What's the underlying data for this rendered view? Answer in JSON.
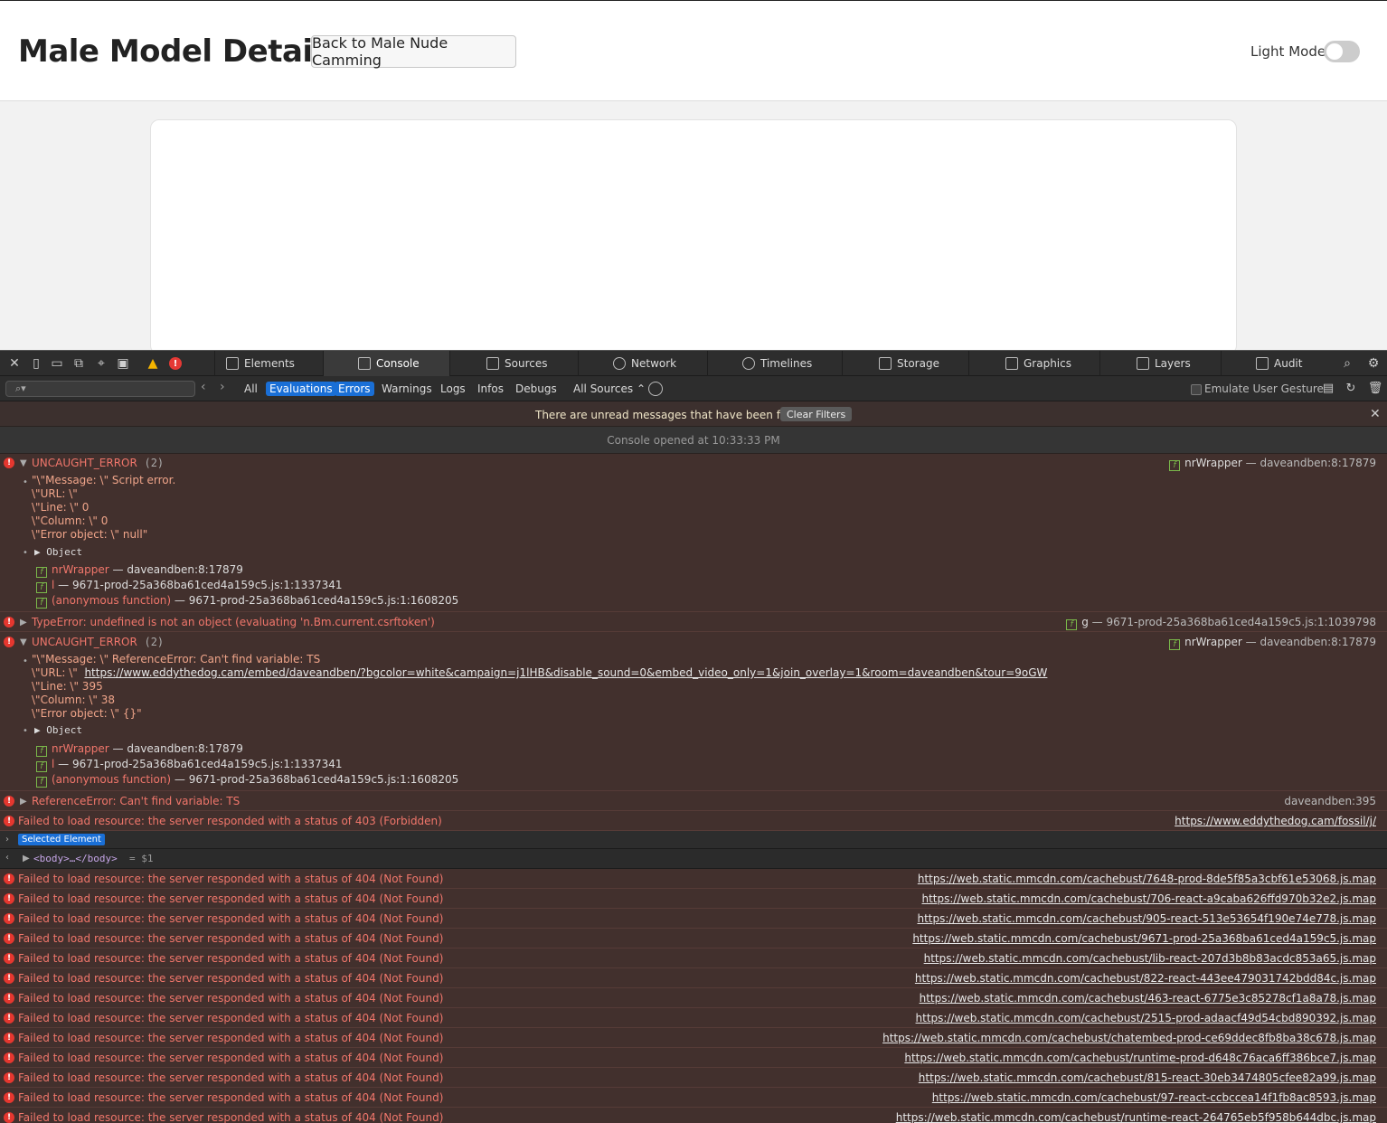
{
  "page": {
    "title": "Male Model Details",
    "back_button": "Back to Male Nude Camming",
    "light_mode_label": "Light Mode"
  },
  "devtools": {
    "tabs": [
      "Elements",
      "Console",
      "Sources",
      "Network",
      "Timelines",
      "Storage",
      "Graphics",
      "Layers",
      "Audit"
    ],
    "levels": [
      "All",
      "Evaluations",
      "Errors",
      "Warnings",
      "Logs",
      "Infos",
      "Debugs"
    ],
    "sources_select": "All Sources ⌃",
    "emulate_label": "Emulate User Gesture",
    "filter_banner": "There are unread messages that have been filtered",
    "clear_filters": "Clear Filters",
    "console_opened": "Console opened at 10:33:33 PM",
    "selected_element": "Selected Element",
    "eval_line": "<body>…</body>",
    "eval_result": "= $1"
  },
  "messages": {
    "m1": {
      "title": "UNCAUGHT_ERROR",
      "count": "(2)",
      "loc_fn": "nrWrapper",
      "loc_file": "— daveandben:8:17879",
      "lines": [
        "\"\\\"Message: \\\" Script error.",
        "\\\"URL: \\\"",
        "\\\"Line: \\\" 0",
        "\\\"Column: \\\" 0",
        "\\\"Error object: \\\" null\""
      ],
      "object": "Object",
      "stack": [
        {
          "fn": "nrWrapper",
          "loc": "— daveandben:8:17879"
        },
        {
          "fn": "l",
          "loc": "— 9671-prod-25a368ba61ced4a159c5.js:1:1337341"
        },
        {
          "fn": "(anonymous function)",
          "loc": "— 9671-prod-25a368ba61ced4a159c5.js:1:1608205"
        }
      ]
    },
    "m2": {
      "title": "TypeError: undefined is not an object (evaluating 'n.Bm.current.csrftoken')",
      "loc_fn": "g",
      "loc_file": "— 9671-prod-25a368ba61ced4a159c5.js:1:1039798"
    },
    "m3": {
      "title": "UNCAUGHT_ERROR",
      "count": "(2)",
      "loc_fn": "nrWrapper",
      "loc_file": "— daveandben:8:17879",
      "line1": "\"\\\"Message: \\\" ReferenceError: Can't find variable: TS",
      "url_label": "\\\"URL: \\\"",
      "url": "https://www.eddythedog.cam/embed/daveandben/?bgcolor=white&campaign=j1lHB&disable_sound=0&embed_video_only=1&join_overlay=1&room=daveandben&tour=9oGW",
      "lines": [
        "\\\"Line: \\\" 395",
        "\\\"Column: \\\" 38",
        "\\\"Error object: \\\" {}\""
      ],
      "object": "Object",
      "stack": [
        {
          "fn": "nrWrapper",
          "loc": "— daveandben:8:17879"
        },
        {
          "fn": "l",
          "loc": "— 9671-prod-25a368ba61ced4a159c5.js:1:1337341"
        },
        {
          "fn": "(anonymous function)",
          "loc": "— 9671-prod-25a368ba61ced4a159c5.js:1:1608205"
        }
      ]
    },
    "m4": {
      "title": "ReferenceError: Can't find variable: TS",
      "loc": "daveandben:395"
    },
    "m5": {
      "title": "Failed to load resource: the server responded with a status of 403 (Forbidden)",
      "url": "https://www.eddythedog.cam/fossil/j/"
    }
  },
  "failures": {
    "text": "Failed to load resource: the server responded with a status of 404 (Not Found)",
    "urls": [
      "https://web.static.mmcdn.com/cachebust/7648-prod-8de5f85a3cbf61e53068.js.map",
      "https://web.static.mmcdn.com/cachebust/706-react-a9caba626ffd970b32e2.js.map",
      "https://web.static.mmcdn.com/cachebust/905-react-513e53654f190e74e778.js.map",
      "https://web.static.mmcdn.com/cachebust/9671-prod-25a368ba61ced4a159c5.js.map",
      "https://web.static.mmcdn.com/cachebust/lib-react-207d3b8b83acdc853a65.js.map",
      "https://web.static.mmcdn.com/cachebust/822-react-443ee479031742bdd84c.js.map",
      "https://web.static.mmcdn.com/cachebust/463-react-6775e3c85278cf1a8a78.js.map",
      "https://web.static.mmcdn.com/cachebust/2515-prod-adaacf49d54cbd890392.js.map",
      "https://web.static.mmcdn.com/cachebust/chatembed-prod-ce69ddec8fb8ba38c678.js.map",
      "https://web.static.mmcdn.com/cachebust/runtime-prod-d648c76aca6ff386bce7.js.map",
      "https://web.static.mmcdn.com/cachebust/815-react-30eb3474805cfee82a99.js.map",
      "https://web.static.mmcdn.com/cachebust/97-react-ccbccea14f1fb8ac8593.js.map",
      "https://web.static.mmcdn.com/cachebust/runtime-react-264765eb5f958b644dbc.js.map"
    ]
  }
}
